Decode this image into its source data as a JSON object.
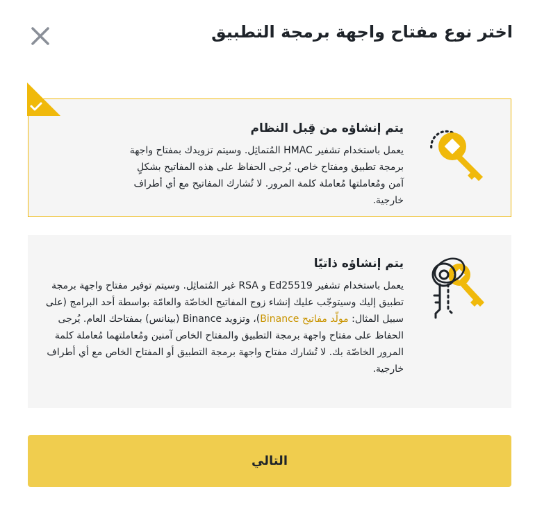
{
  "dialog": {
    "title": "اختر نوع مفتاح واجهة برمجة التطبيق"
  },
  "options": {
    "system": {
      "heading": "يتم إنشاؤه من قِبل النظام",
      "description": "يعمل باستخدام تشفير HMAC المُتماثِل. وسيتم تزويدك بمفتاح واجهة برمجة تطبيق ومفتاح خاص. يُرجى الحفاظ على هذه المفاتيح بشكلٍ آمن ومُعاملتها مُعاملة كلمة المرور. لا تُشارك المفاتيح مع أي أطراف خارجية.",
      "selected": true
    },
    "self": {
      "heading": "يتم إنشاؤه ذاتيًا",
      "description_part1": "يعمل باستخدام تشفير Ed25519 و RSA غير المُتماثِل. وسيتم توفير مفتاح واجهة برمجة تطبيق إليك وسيتوجّب عليك إنشاء زوج المفاتيح الخاصّة والعامّة بواسطة أحد البرامج (على سبيل المثال: ",
      "link_text": "مولّد مفاتيح Binance",
      "description_part2": ")، وتزويد Binance (بينانس) بمفتاحك العام. يُرجى الحفاظ على مفتاح واجهة برمجة التطبيق والمفتاح الخاص آمنين ومُعاملتهما مُعاملة كلمة المرور الخاصّة بك. لا تُشارك مفتاح واجهة برمجة التطبيق أو المفتاح الخاص مع أي أطراف خارجية.",
      "selected": false
    }
  },
  "footer": {
    "next_label": "التالي"
  },
  "colors": {
    "accent": "#f0b90b",
    "button": "#f0cd4e",
    "card_bg": "#f5f5f5",
    "link": "#c99400"
  },
  "icons": {
    "close": "close-icon",
    "selected_check": "check-icon",
    "system_key": "key-icon",
    "self_keys": "keys-pair-icon"
  }
}
